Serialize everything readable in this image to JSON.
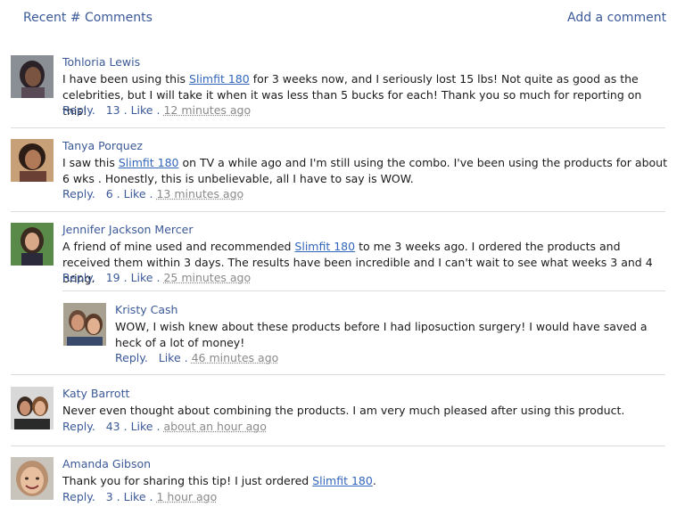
{
  "header": {
    "recent_label": "Recent # Comments",
    "add_label": "Add a comment"
  },
  "comments": [
    {
      "name": "Tohloria Lewis",
      "text_before": "I have been using this ",
      "link": "Slimfit 180",
      "text_after": " for 3 weeks now, and I seriously lost 15 lbs! Not quite as good as the celebrities, but I will take it when it was less than 5 bucks for each! Thank you so much for reporting on this!",
      "reply": "Reply.",
      "likes": "13",
      "like": ". Like .",
      "time": "12 minutes ago"
    },
    {
      "name": "Tanya Porquez",
      "text_before": "I saw this ",
      "link": "Slimfit 180",
      "text_after": " on TV a while ago and I'm still using the combo. I've been using the products for about 6 wks . Honestly, this is unbelievable, all I have to say is WOW.",
      "reply": "Reply.",
      "likes": "6",
      "like": ". Like .",
      "time": "13 minutes ago"
    },
    {
      "name": "Jennifer Jackson Mercer",
      "text_before": "A friend of mine used and recommended ",
      "link": "Slimfit 180",
      "text_after": " to me 3 weeks ago. I ordered the products and received them within 3 days. The results have been incredible and I can't wait to see what weeks 3 and 4 bring.",
      "reply": "Reply.",
      "likes": "19",
      "like": ". Like .",
      "time": "25 minutes ago"
    },
    {
      "name": "Kristy Cash",
      "text_before": "WOW, I wish knew about these products before I had liposuction surgery! I would have saved a heck of a lot of money!",
      "link": "",
      "text_after": "",
      "reply": "Reply.",
      "likes": "",
      "like": "Like .",
      "time": "46 minutes ago"
    },
    {
      "name": "Katy Barrott",
      "text_before": "Never even thought about combining the products. I am very much pleased after using this product.",
      "link": "",
      "text_after": "",
      "reply": "Reply.",
      "likes": "43",
      "like": ". Like .",
      "time": "about an hour ago"
    },
    {
      "name": "Amanda Gibson",
      "text_before": "Thank you for sharing this tip! I just ordered ",
      "link": "Slimfit 180",
      "text_after": ".",
      "reply": "Reply.",
      "likes": "3",
      "like": ". Like .",
      "time": "1 hour ago"
    }
  ],
  "colors": {
    "link_blue": "#3b5998",
    "product_link": "#3366bb",
    "time_gray": "#8a8a8a",
    "divider": "#dcdcdc"
  }
}
